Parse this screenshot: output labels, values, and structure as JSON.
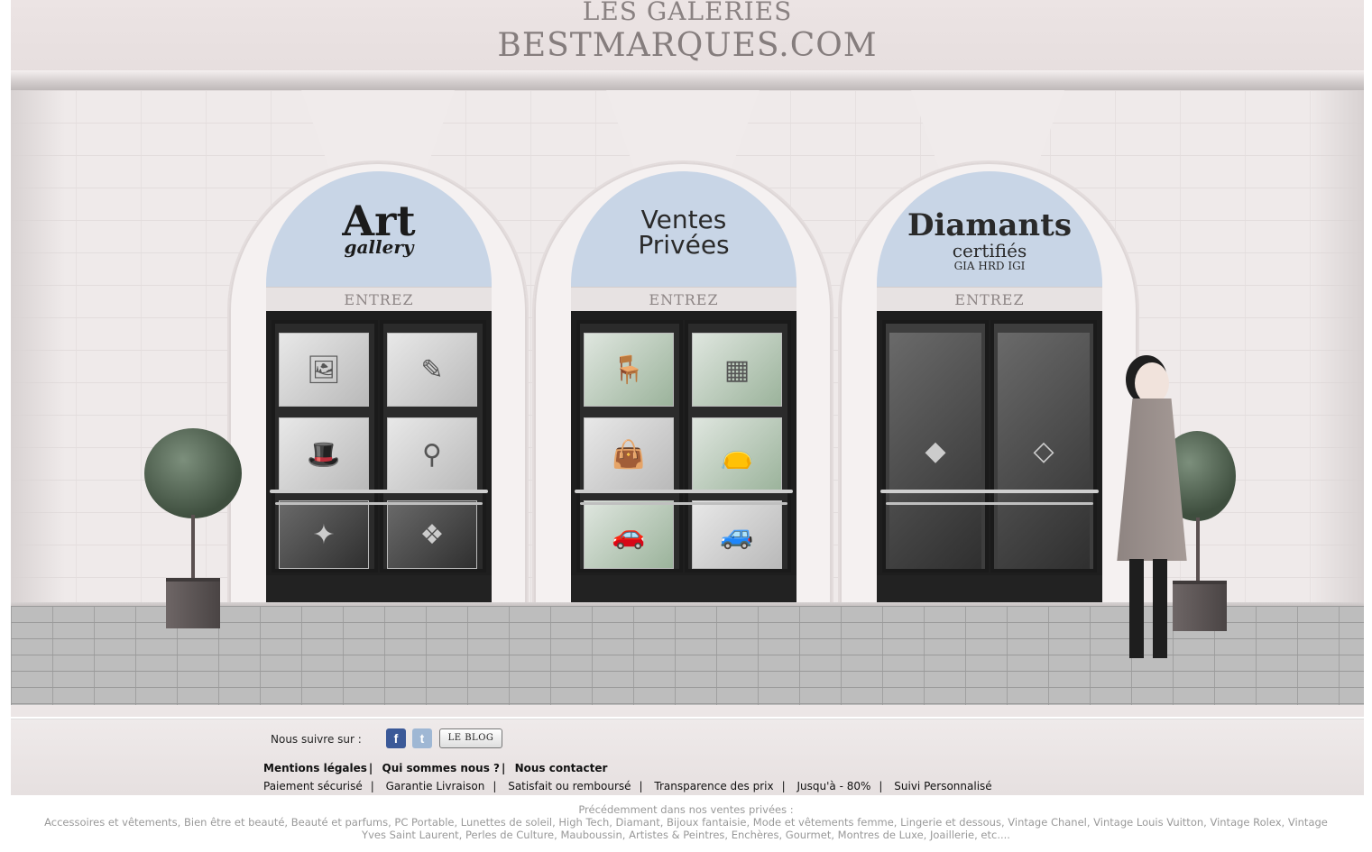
{
  "brand": {
    "top": "LES GALERIES",
    "main": "BESTMARQUES.COM"
  },
  "shops": [
    {
      "sign_big": "Art",
      "sign_small": "gallery",
      "enter": "ENTREZ"
    },
    {
      "sign_line1": "Ventes",
      "sign_line2": "Privées",
      "enter": "ENTREZ"
    },
    {
      "sign_big": "Diamants",
      "sign_mid": "certifiés",
      "sign_small": "GIA HRD IGI",
      "enter": "ENTREZ"
    }
  ],
  "footer": {
    "follow_label": "Nous suivre sur :",
    "blog_button": "LE BLOG",
    "links_primary": [
      "Mentions légales",
      "Qui sommes nous ?",
      "Nous contacter"
    ],
    "links_secondary": [
      "Paiement sécurisé",
      "Garantie Livraison",
      "Satisfait ou remboursé",
      "Transparence des prix",
      "Jusqu'à - 80%",
      "Suivi Personnalisé"
    ]
  },
  "previous_sales": {
    "label": "Précédemment dans nos ventes privées :",
    "categories": "Accessoires et vêtements, Bien être et beauté, Beauté et parfums, PC Portable, Lunettes de soleil, High Tech, Diamant, Bijoux fantaisie, Mode et vêtements femme, Lingerie et dessous, Vintage Chanel, Vintage Louis Vuitton, Vintage Rolex, Vintage Yves Saint Laurent, Perles de Culture, Mauboussin, Artistes & Peintres, Enchères, Gourmet, Montres de Luxe, Joaillerie, etc...."
  },
  "colors": {
    "facade": "#efeaea",
    "arch_window": "#c8d5e6",
    "door": "#1e1e1e",
    "facebook": "#3b5998"
  }
}
